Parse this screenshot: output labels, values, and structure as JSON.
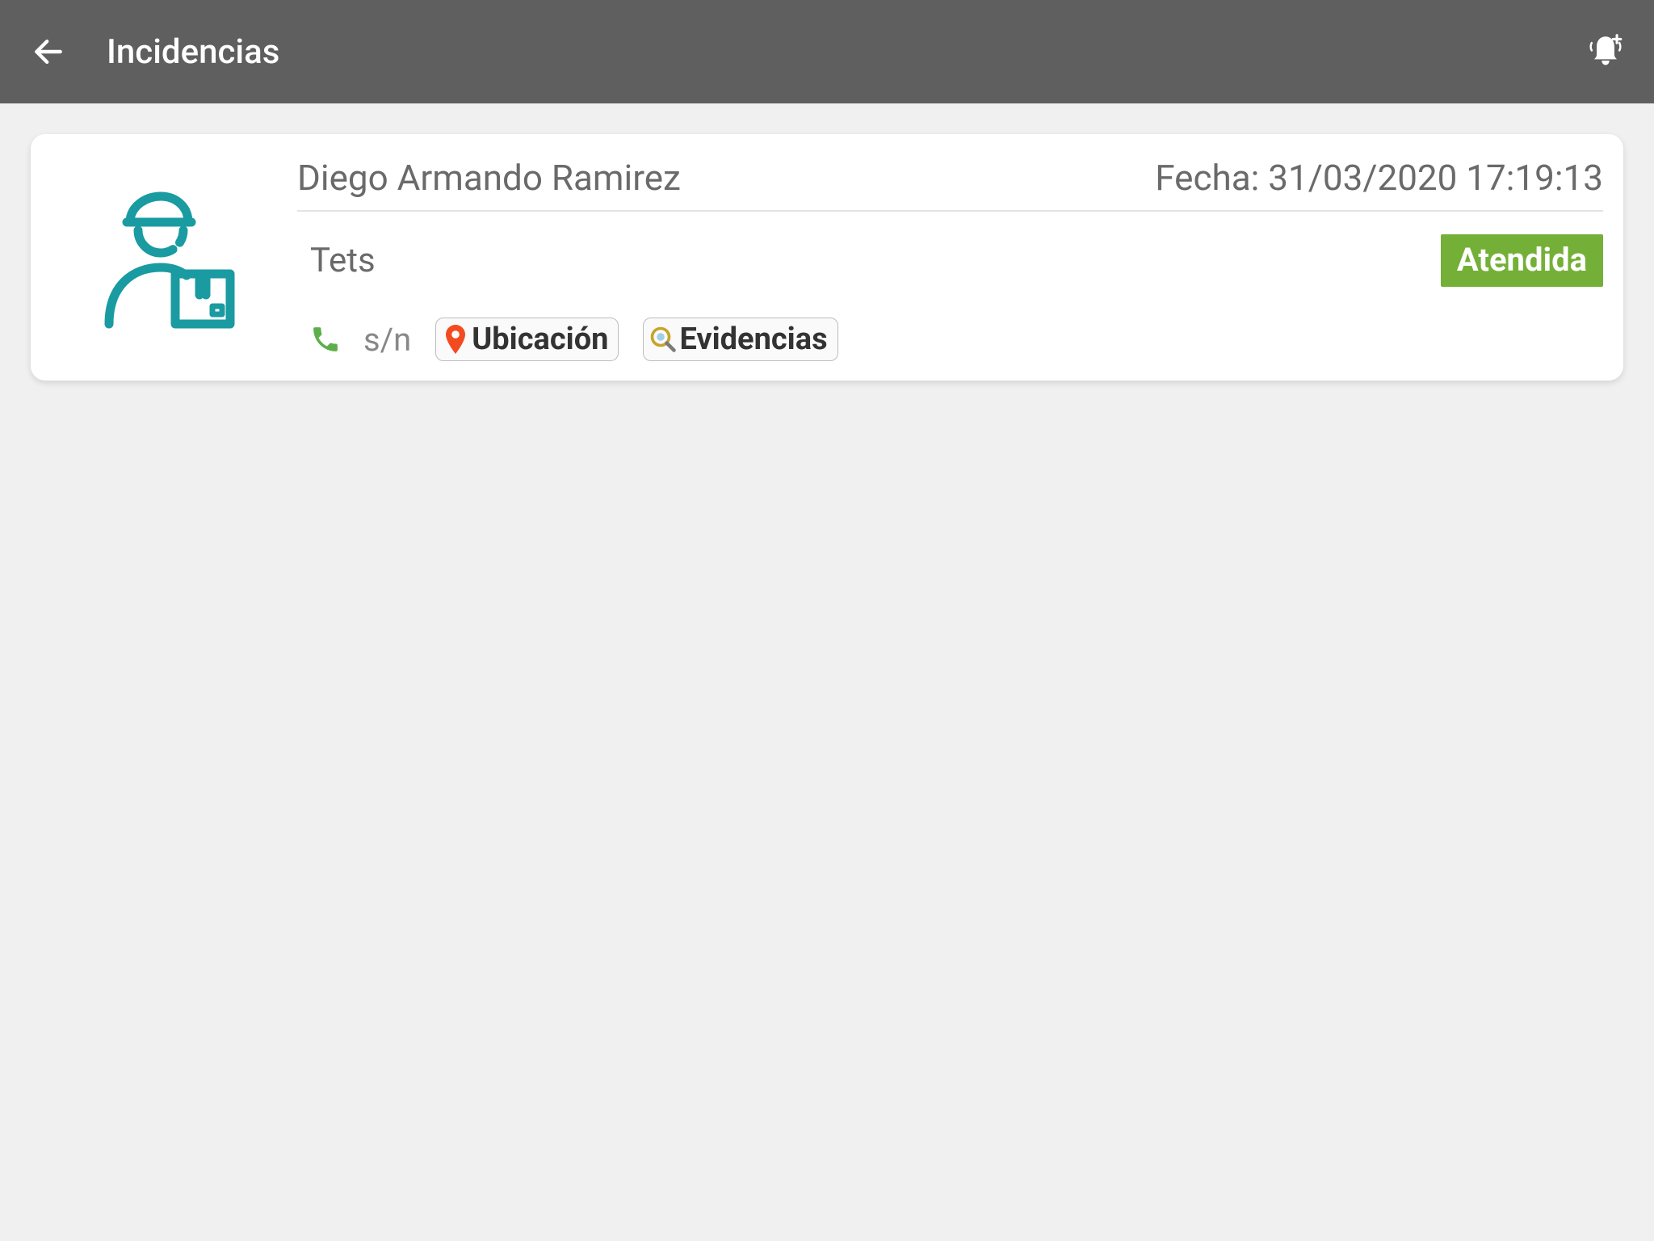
{
  "header": {
    "title": "Incidencias"
  },
  "incident": {
    "name": "Diego Armando Ramirez",
    "date_label": "Fecha: 31/03/2020 17:19:13",
    "description": "Tets",
    "status_label": "Atendida",
    "phone_number": "s/n",
    "location_label": "Ubicación",
    "evidence_label": "Evidencias"
  },
  "colors": {
    "teal": "#1a9ba1",
    "green_badge": "#74b037",
    "pin_red": "#f44a1f"
  }
}
